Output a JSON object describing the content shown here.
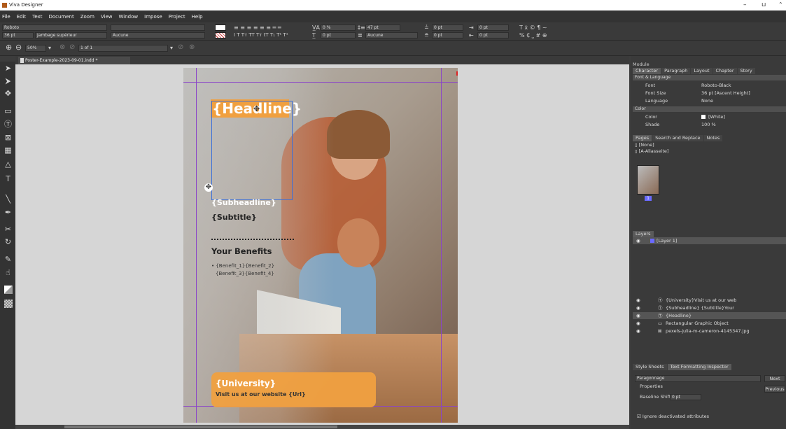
{
  "app": {
    "title": "Viva Designer"
  },
  "menu": [
    "File",
    "Edit",
    "Text",
    "Document",
    "Zoom",
    "View",
    "Window",
    "Impose",
    "Project",
    "Help"
  ],
  "toolbar": {
    "font": "Roboto",
    "size": "36 pt",
    "style": "Jambage supérieur",
    "frame_rule": "Aucune",
    "tracking": "0 %",
    "leading": "47 pt",
    "baseline": "0 pt",
    "para_rule": "Aucune",
    "space_before": "0 pt",
    "space_after": "0 pt",
    "indent_left": "0 pt",
    "indent_right": "0 pt",
    "indent_first": "0 pt",
    "zoom": "50%",
    "page_nav": "1 of 1"
  },
  "document": {
    "tab": "Poster-Example-2023-09-01.indd *"
  },
  "poster": {
    "headline": "{Headline}",
    "subheadline": "{Subheadline}",
    "subtitle": "{Subtitle}",
    "benefits_title": "Your Benefits",
    "benefits_line1": "• {Benefit_1}{Benefit_2}",
    "benefits_line2": "{Benefit_3}{Benefit_4}",
    "university": "{University}",
    "visit": "Visit us at our website {Url}"
  },
  "panel": {
    "module": "Module",
    "tabs": [
      "Character",
      "Paragraph",
      "Layout",
      "Chapter",
      "Story"
    ],
    "section_font": "Font & Language",
    "font_label": "Font",
    "font_value": "Roboto-Black",
    "size_label": "Font Size",
    "size_value": "36 pt [Ascent Height]",
    "lang_label": "Language",
    "lang_value": "None",
    "section_color": "Color",
    "color_label": "Color",
    "color_value": "[White]",
    "shade_label": "Shade",
    "shade_value": "100 %",
    "pages_tabs": [
      "Pages",
      "Search and Replace",
      "Notes"
    ],
    "master1": "[None]",
    "master2": "[A-Aliasseite]",
    "page_number": "1",
    "layers_title": "Layers",
    "layer1": "[Layer 1]",
    "objects": [
      "{University}Visit us at our web",
      "{Subheadline} {Subtitle}Your",
      "{Headline}",
      "Rectangular Graphic Object",
      "pexels-julia-m-cameron-4145347.jpg"
    ],
    "style_tabs": [
      "Style Sheets",
      "Text Formatting Inspector"
    ],
    "para_style": "Paragonnage",
    "properties": "Properties",
    "baseline_label": "Baseline Shift:",
    "baseline_value": "0 pt",
    "next": "Next",
    "previous": "Previous",
    "ignore": "Ignore deactivated attributes"
  },
  "colors": {
    "accent": "#f0a040",
    "selection": "#3b6fd8",
    "guide": "#8a44c8"
  }
}
